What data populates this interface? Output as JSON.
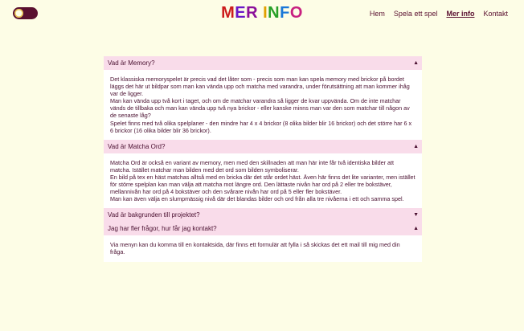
{
  "header": {
    "logo_letters": [
      "M",
      "E",
      "R",
      " ",
      "I",
      "N",
      "F",
      "O"
    ],
    "logo_colors": [
      "#cc1c1c",
      "#6a18c8",
      "#8a0f9a",
      "#000000",
      "#e0a000",
      "#28a028",
      "#1a78d8",
      "#c82080"
    ],
    "nav": [
      {
        "label": "Hem",
        "active": false
      },
      {
        "label": "Spela ett spel",
        "active": false
      },
      {
        "label": "Mer info",
        "active": true
      },
      {
        "label": "Kontakt",
        "active": false
      }
    ]
  },
  "faq": [
    {
      "question": "Vad är Memory?",
      "expanded": true,
      "arrow": "▲",
      "answer": [
        "Det klassiska memoryspelet är precis vad det låter som - precis som man kan spela memory med brickor på bordet läggs det här ut bildpar som man kan vända upp och matcha med varandra, under förutsättning att man kommer ihåg var de ligger.",
        "Man kan vända upp två kort i taget, och om de matchar varandra så ligger de kvar uppvända. Om de inte matchar vänds de tillbaka och man kan vända upp två nya brickor - eller kanske minns man var den som matchar till någon av de senaste låg?",
        "Spelet finns med två olika spelplaner - den mindre har 4 x 4 brickor (8 olika bilder blir 16 brickor) och det större har 6 x 6 brickor (16 olika bilder blir 36 brickor)."
      ]
    },
    {
      "question": "Vad är Matcha Ord?",
      "expanded": true,
      "arrow": "▲",
      "answer": [
        "Matcha Ord är också en variant av memory, men med den skillnaden att man här inte får två identiska bilder att matcha. Istället matchar man bilden med det ord som bilden symboliserar.",
        "En bild på tex en häst matchas alltså med en bricka där det står ordet häst. Även här finns det lite varianter, men istället för större spelplan kan man välja att matcha mot längre ord. Den lättaste nivån har ord på 2 eller tre bokstäver, mellannivån har ord på 4 bokstäver och den svårare nivån har ord på 5 eller fler bokstäver.",
        "Man kan även välja en slumpmässig nivå där det blandas bilder och ord från alla tre nivåerna i ett och samma spel."
      ]
    },
    {
      "question": "Vad är bakgrunden till projektet?",
      "expanded": false,
      "arrow": "▼",
      "answer": []
    },
    {
      "question": "Jag har fler frågor, hur får jag kontakt?",
      "expanded": true,
      "arrow": "▲",
      "answer": [
        "Via menyn kan du komma till en kontaktsida, där finns ett formulär att fylla i så skickas det ett mail till mig med din fråga."
      ]
    }
  ]
}
